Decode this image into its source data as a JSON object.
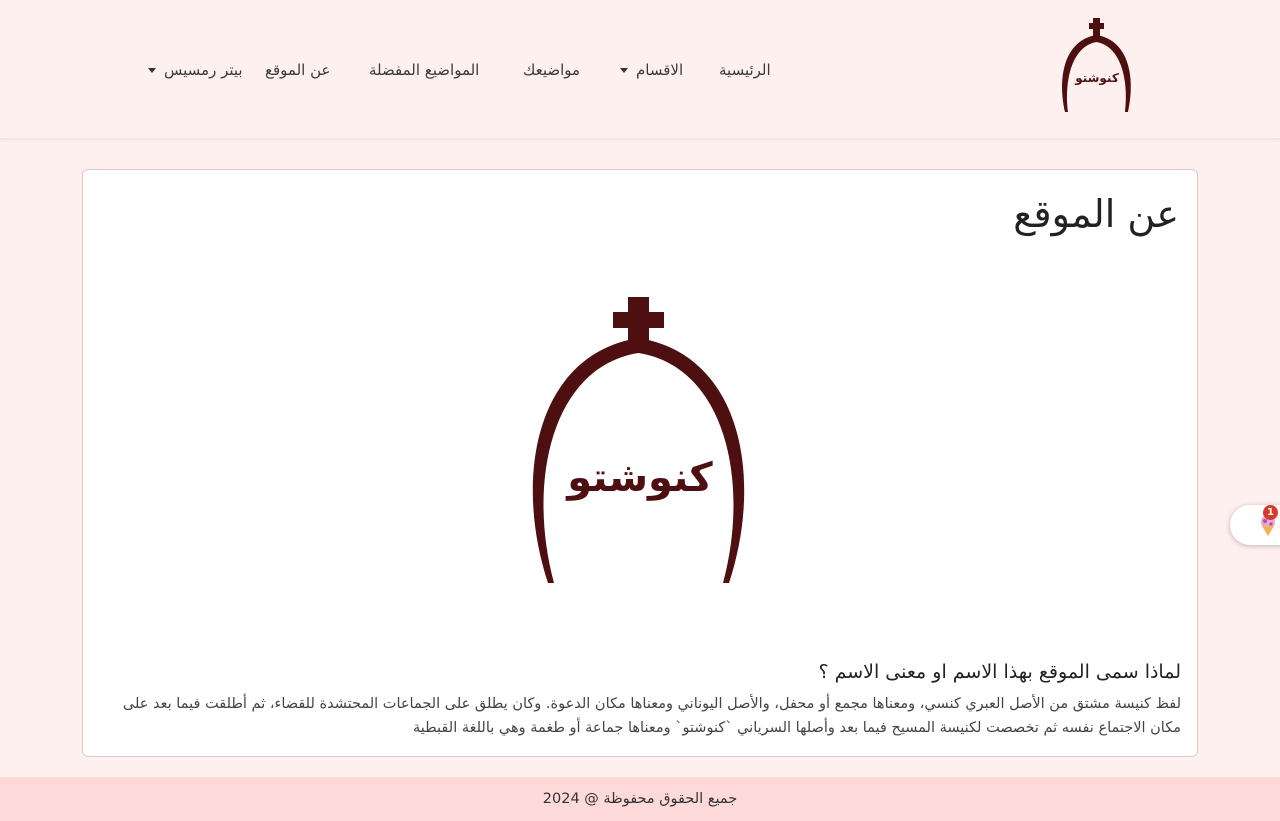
{
  "brand": {
    "logo_text": "كنوشتو",
    "icon": "church-cross-logo-icon"
  },
  "nav": {
    "home": "الرئيسية",
    "sections": "الاقسام",
    "topics": "مواضيعك",
    "favorites": "المواضيع المفضلة",
    "about": "عن الموقع",
    "user": "بيتر رمسيس"
  },
  "page": {
    "title": "عن الموقع",
    "question": "لماذا سمى الموقع بهذا الاسم او معنى الاسم ؟",
    "body": "لفظ كنيسة مشتق من الأصل العبري كنسي، ومعناها مجمع أو محفل، والأصل اليوناني ومعناها مكان الدعوة. وكان يطلق على الجماعات المحتشدة للقضاء، ثم أطلقت فيما بعد على مكان الاجتماع نفسه ثم تخصصت لكنيسة المسيح فيما بعد وأصلها السرياني `كنوشتو` ومعناها جماعة أو طغمة وهي باللغة القبطية"
  },
  "footer": {
    "copyright": "جميع الحقوق محفوظة @ 2024"
  },
  "widget": {
    "badge": "1",
    "icon": "ice-cream-icon"
  },
  "colors": {
    "background": "#fff0f0",
    "footer": "#fdd9d9",
    "logo": "#4e0f10",
    "badge": "#d63a2a"
  }
}
